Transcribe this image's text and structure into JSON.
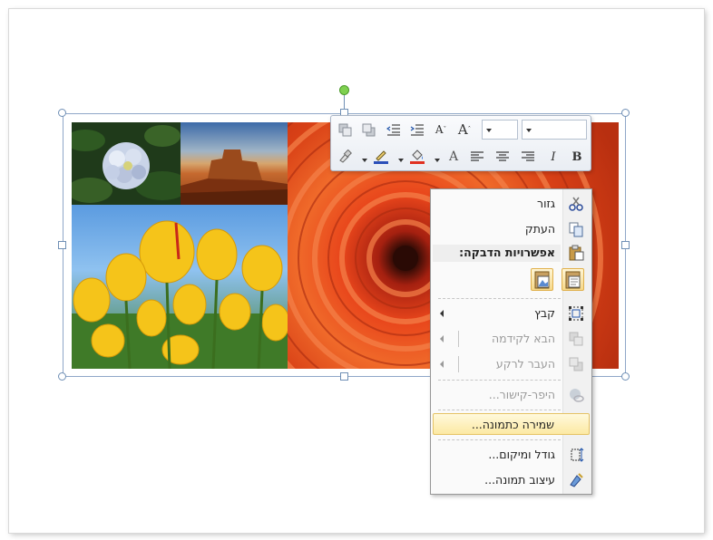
{
  "context_menu": {
    "items": [
      {
        "label": "גזור",
        "icon": "scissors-icon"
      },
      {
        "label": "העתק",
        "icon": "copy-icon"
      },
      {
        "label": "אפשרויות הדבקה:",
        "icon": "paste-icon"
      },
      {
        "label": "קבץ",
        "icon": "group-icon"
      },
      {
        "label": "הבא לקידמה",
        "icon": "bring-forward-icon"
      },
      {
        "label": "העבר לרקע",
        "icon": "send-backward-icon"
      },
      {
        "label": "היפר-קישור...",
        "icon": "hyperlink-icon"
      },
      {
        "label": "שמירה כתמונה...",
        "icon": ""
      },
      {
        "label": "גודל ומיקום...",
        "icon": "size-position-icon"
      },
      {
        "label": "עיצוב תמונה...",
        "icon": "format-picture-icon"
      }
    ],
    "paste_options": [
      "paste-picture-icon",
      "paste-keep-text-icon"
    ]
  },
  "mini_toolbar": {
    "row1": [
      "bring-forward-icon",
      "send-backward-icon",
      "decrease-indent-icon",
      "increase-indent-icon",
      "shrink-font-icon",
      "grow-font-icon"
    ],
    "font_name": "",
    "font_size": "",
    "row2": [
      "format-painter-icon",
      "font-color-icon",
      "fill-color-icon",
      "text-effect-icon",
      "align-left-icon",
      "center-icon",
      "align-right-icon",
      "italic-icon",
      "bold-icon"
    ],
    "shrink_label": "A",
    "grow_label": "A",
    "italic_label": "I",
    "bold_label": "B",
    "text_label": "A"
  },
  "colors": {
    "highlight": "#fce9a3",
    "font_color_bar": "#2b4fb8",
    "fill_color_bar": "#e03020",
    "rotation_handle": "#7ed050"
  }
}
